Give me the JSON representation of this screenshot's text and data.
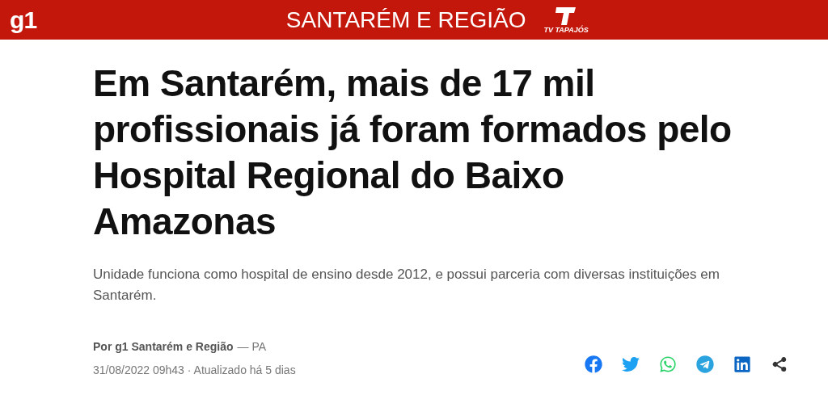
{
  "header": {
    "logo": "g1",
    "section": "SANTARÉM E REGIÃO",
    "partner_logo": "TV TAPAJÓS"
  },
  "headline": "Em Santarém, mais de 17 mil profissionais já foram formados pelo Hospital Regional do Baixo Amazonas",
  "subtitle": "Unidade funciona como hospital de ensino desde 2012, e possui parceria com diversas instituições em Santarém.",
  "byline": {
    "author": "Por g1 Santarém e Região",
    "region": "— PA",
    "date": "31/08/2022 09h43 · Atualizado há 5 dias"
  },
  "share": [
    {
      "kind": "facebook"
    },
    {
      "kind": "twitter"
    },
    {
      "kind": "whatsapp"
    },
    {
      "kind": "telegram"
    },
    {
      "kind": "linkedin"
    },
    {
      "kind": "share"
    }
  ]
}
